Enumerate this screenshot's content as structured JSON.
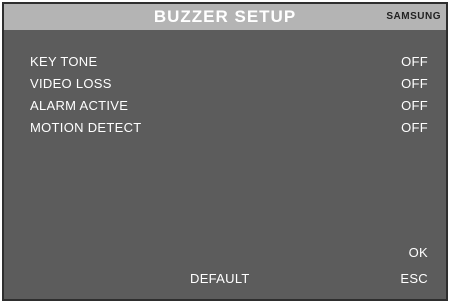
{
  "header": {
    "title": "BUZZER SETUP",
    "brand": "SAMSUNG"
  },
  "menu": {
    "items": [
      {
        "label": "KEY TONE",
        "value": "OFF"
      },
      {
        "label": "VIDEO LOSS",
        "value": "OFF"
      },
      {
        "label": "ALARM ACTIVE",
        "value": "OFF"
      },
      {
        "label": "MOTION DETECT",
        "value": "OFF"
      }
    ]
  },
  "footer": {
    "ok_label": "OK",
    "default_label": "DEFAULT",
    "esc_label": "ESC"
  },
  "colors": {
    "background": "#5c5c5c",
    "header": "#b4b4b4",
    "text": "#ffffff"
  }
}
